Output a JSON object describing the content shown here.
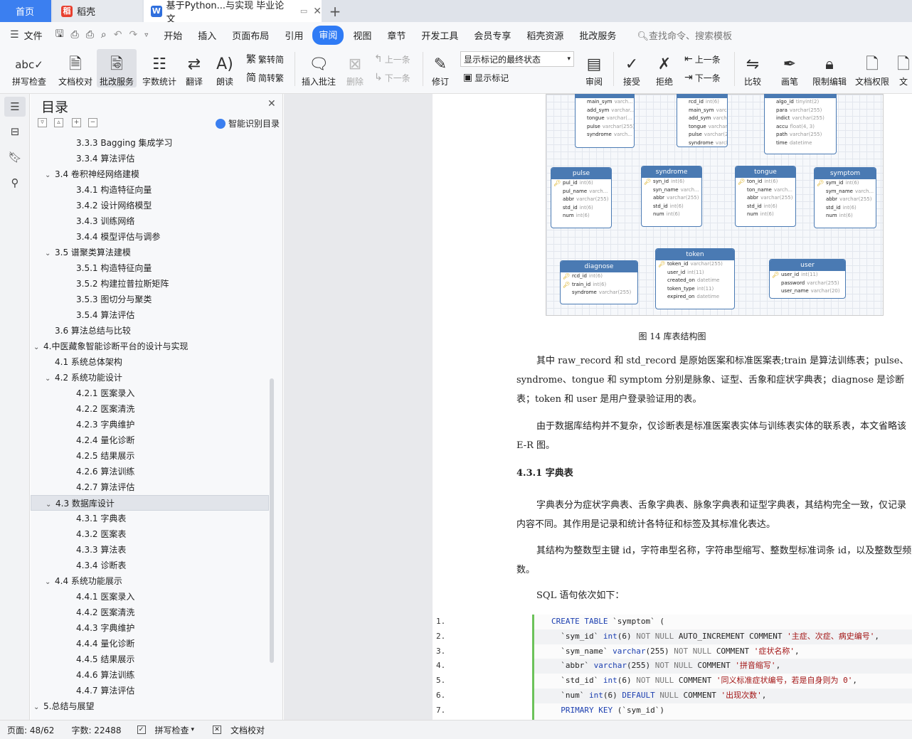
{
  "tabs": {
    "home": "首页",
    "daoke": "稻壳",
    "doc": "基于Python...与实现 毕业论文"
  },
  "menu": {
    "file": "文件",
    "items": [
      "开始",
      "插入",
      "页面布局",
      "引用",
      "审阅",
      "视图",
      "章节",
      "开发工具",
      "会员专享",
      "稻壳资源",
      "批改服务"
    ],
    "active_index": 4,
    "search": "查找命令、搜索模板"
  },
  "ribbon": {
    "spell": "拼写检查",
    "proofread": "文档校对",
    "review_service": "批改服务",
    "wordcount": "字数统计",
    "translate": "翻译",
    "read_aloud": "朗读",
    "trad_simp": "繁转简",
    "simp_trad": "简转繁",
    "insert_comment": "插入批注",
    "delete": "删除",
    "prev": "上一条",
    "next": "下一条",
    "revise": "修订",
    "mark_state": "显示标记的最终状态",
    "show_marks": "显示标记",
    "review": "审阅",
    "accept": "接受",
    "reject": "拒绝",
    "prev2": "上一条",
    "next2": "下一条",
    "compare": "比较",
    "brush": "画笔",
    "restrict": "限制编辑",
    "permission": "文档权限",
    "more": "文"
  },
  "toc": {
    "title": "目录",
    "smart": "智能识别目录",
    "items": [
      {
        "level": 3,
        "text": "3.3.3 Bagging 集成学习"
      },
      {
        "level": 3,
        "text": "3.3.4 算法评估"
      },
      {
        "level": 2,
        "text": "3.4 卷积神经网络建模",
        "caret": true
      },
      {
        "level": 3,
        "text": "3.4.1 构造特征向量"
      },
      {
        "level": 3,
        "text": "3.4.2 设计网络模型"
      },
      {
        "level": 3,
        "text": "3.4.3  训练网络"
      },
      {
        "level": 3,
        "text": "3.4.4 模型评估与调参"
      },
      {
        "level": 2,
        "text": "3.5 谱聚类算法建模",
        "caret": true
      },
      {
        "level": 3,
        "text": "3.5.1 构造特征向量"
      },
      {
        "level": 3,
        "text": "3.5.2 构建拉普拉斯矩阵"
      },
      {
        "level": 3,
        "text": "3.5.3 图切分与聚类"
      },
      {
        "level": 3,
        "text": "3.5.4 算法评估"
      },
      {
        "level": 2,
        "text": "3.6 算法总结与比较"
      },
      {
        "level": 1,
        "text": "4.中医藏象智能诊断平台的设计与实现",
        "caret": true
      },
      {
        "level": 2,
        "text": "4.1 系统总体架构"
      },
      {
        "level": 2,
        "text": "4.2 系统功能设计",
        "caret": true
      },
      {
        "level": 3,
        "text": "4.2.1 医案录入"
      },
      {
        "level": 3,
        "text": "4.2.2 医案清洗"
      },
      {
        "level": 3,
        "text": "4.2.3 字典维护"
      },
      {
        "level": 3,
        "text": "4.2.4 量化诊断"
      },
      {
        "level": 3,
        "text": "4.2.5 结果展示"
      },
      {
        "level": 3,
        "text": "4.2.6 算法训练"
      },
      {
        "level": 3,
        "text": "4.2.7 算法评估"
      },
      {
        "level": 2,
        "text": "4.3 数据库设计",
        "caret": true,
        "selected": true
      },
      {
        "level": 3,
        "text": "4.3.1 字典表"
      },
      {
        "level": 3,
        "text": "4.3.2 医案表"
      },
      {
        "level": 3,
        "text": "4.3.3 算法表"
      },
      {
        "level": 3,
        "text": "4.3.4 诊断表"
      },
      {
        "level": 2,
        "text": "4.4 系统功能展示",
        "caret": true
      },
      {
        "level": 3,
        "text": "4.4.1 医案录入"
      },
      {
        "level": 3,
        "text": "4.4.2 医案清洗"
      },
      {
        "level": 3,
        "text": "4.4.3 字典维护"
      },
      {
        "level": 3,
        "text": "4.4.4 量化诊断"
      },
      {
        "level": 3,
        "text": "4.4.5 结果展示"
      },
      {
        "level": 3,
        "text": "4.4.6 算法训练"
      },
      {
        "level": 3,
        "text": "4.4.7 算法评估"
      },
      {
        "level": 1,
        "text": "5.总结与展望",
        "caret": true
      }
    ]
  },
  "er": {
    "tables": [
      {
        "name": "",
        "fields": [
          [
            "",
            "main_sym",
            "varch..."
          ],
          [
            "",
            "add_sym",
            "varchar..."
          ],
          [
            "",
            "tongue",
            "varchar(..."
          ],
          [
            "",
            "pulse",
            "varchar(255)"
          ],
          [
            "",
            "syndrome",
            "varch..."
          ]
        ]
      },
      {
        "name": "",
        "fields": [
          [
            "",
            "rcd_id",
            "int(6)"
          ],
          [
            "",
            "main_sym",
            "varch..."
          ],
          [
            "",
            "add_sym",
            "varchar..."
          ],
          [
            "",
            "tongue",
            "varchar(..."
          ],
          [
            "",
            "pulse",
            "varchar(255)"
          ],
          [
            "",
            "syndrome",
            "varch..."
          ]
        ]
      },
      {
        "name": "",
        "fields": [
          [
            "",
            "algo_id",
            "tinyint(2)"
          ],
          [
            "",
            "para",
            "varchar(255)"
          ],
          [
            "",
            "indict",
            "varchar(255)"
          ],
          [
            "",
            "accu",
            "float(4, 3)"
          ],
          [
            "",
            "path",
            "varchar(255)"
          ],
          [
            "",
            "time",
            "datetime"
          ]
        ]
      },
      {
        "name": "pulse",
        "fields": [
          [
            "k",
            "pul_id",
            "int(6)"
          ],
          [
            "",
            "pul_name",
            "varch..."
          ],
          [
            "",
            "abbr",
            "varchar(255)"
          ],
          [
            "",
            "std_id",
            "int(6)"
          ],
          [
            "",
            "num",
            "int(6)"
          ]
        ]
      },
      {
        "name": "syndrome",
        "fields": [
          [
            "k",
            "syn_id",
            "int(6)"
          ],
          [
            "",
            "syn_name",
            "varch..."
          ],
          [
            "",
            "abbr",
            "varchar(255)"
          ],
          [
            "",
            "std_id",
            "int(6)"
          ],
          [
            "",
            "num",
            "int(6)"
          ]
        ]
      },
      {
        "name": "tongue",
        "fields": [
          [
            "k",
            "ton_id",
            "int(6)"
          ],
          [
            "",
            "ton_name",
            "varch..."
          ],
          [
            "",
            "abbr",
            "varchar(255)"
          ],
          [
            "",
            "std_id",
            "int(6)"
          ],
          [
            "",
            "num",
            "int(6)"
          ]
        ]
      },
      {
        "name": "symptom",
        "fields": [
          [
            "k",
            "sym_id",
            "int(6)"
          ],
          [
            "",
            "sym_name",
            "varch..."
          ],
          [
            "",
            "abbr",
            "varchar(255)"
          ],
          [
            "",
            "std_id",
            "int(6)"
          ],
          [
            "",
            "num",
            "int(6)"
          ]
        ]
      },
      {
        "name": "diagnose",
        "fields": [
          [
            "k",
            "rcd_id",
            "int(6)"
          ],
          [
            "k",
            "train_id",
            "int(6)"
          ],
          [
            "",
            "syndrome",
            "varchar(255)"
          ]
        ]
      },
      {
        "name": "token",
        "fields": [
          [
            "k",
            "token_id",
            "varchar(255)"
          ],
          [
            "",
            "user_id",
            "int(11)"
          ],
          [
            "",
            "created_on",
            "datetime"
          ],
          [
            "",
            "token_type",
            "int(11)"
          ],
          [
            "",
            "expired_on",
            "datetime"
          ]
        ]
      },
      {
        "name": "user",
        "fields": [
          [
            "k",
            "user_id",
            "int(11)"
          ],
          [
            "",
            "password",
            "varchar(255)"
          ],
          [
            "",
            "user_name",
            "varchar(20)"
          ]
        ]
      }
    ]
  },
  "doc": {
    "caption": "图 14  库表结构图",
    "p1": "其中 raw_record 和 std_record 是原始医案和标准医案表;train 是算法训练表；pulse、syndrome、tongue 和 symptom 分别是脉象、证型、舌象和症状字典表；diagnose 是诊断表；token 和 user 是用户登录验证用的表。",
    "p2": "由于数据库结构并不复杂，仅诊断表是标准医案表实体与训练表实体的联系表，本文省略该 E-R 图。",
    "h431": "4.3.1 字典表",
    "p3": "字典表分为症状字典表、舌象字典表、脉象字典表和证型字典表，其结构完全一致，仅记录内容不同。其作用是记录和统计各特征和标签及其标准化表达。",
    "p4": "其结构为整数型主键 id，字符串型名称，字符串型缩写、整数型标准词条 id，以及整数型频数。",
    "sql_intro": "SQL 语句依次如下：",
    "code": [
      {
        "n": "1.",
        "segs": [
          [
            "kw",
            "CREATE TABLE "
          ],
          [
            "",
            "`symptom` ("
          ]
        ]
      },
      {
        "n": "2.",
        "segs": [
          [
            "",
            "  `sym_id` "
          ],
          [
            "kw",
            "int"
          ],
          [
            "",
            "(6) "
          ],
          [
            "kw2",
            "NOT NULL "
          ],
          [
            "",
            "AUTO_INCREMENT COMMENT "
          ],
          [
            "str",
            "'主症、次症、病史编号'"
          ],
          [
            "",
            ","
          ]
        ]
      },
      {
        "n": "3.",
        "segs": [
          [
            "",
            "  `sym_name` "
          ],
          [
            "kw",
            "varchar"
          ],
          [
            "",
            "(255) "
          ],
          [
            "kw2",
            "NOT NULL "
          ],
          [
            "",
            "COMMENT "
          ],
          [
            "str",
            "'症状名称'"
          ],
          [
            "",
            ","
          ]
        ]
      },
      {
        "n": "4.",
        "segs": [
          [
            "",
            "  `abbr` "
          ],
          [
            "kw",
            "varchar"
          ],
          [
            "",
            "(255) "
          ],
          [
            "kw2",
            "NOT NULL "
          ],
          [
            "",
            "COMMENT "
          ],
          [
            "str",
            "'拼音缩写'"
          ],
          [
            "",
            ","
          ]
        ]
      },
      {
        "n": "5.",
        "segs": [
          [
            "",
            "  `std_id` "
          ],
          [
            "kw",
            "int"
          ],
          [
            "",
            "(6) "
          ],
          [
            "kw2",
            "NOT NULL "
          ],
          [
            "",
            "COMMENT "
          ],
          [
            "str",
            "'同义标准症状编号，若是自身则为 0'"
          ],
          [
            "",
            ","
          ]
        ]
      },
      {
        "n": "6.",
        "segs": [
          [
            "",
            "  `num` "
          ],
          [
            "kw",
            "int"
          ],
          [
            "",
            "(6) "
          ],
          [
            "kw",
            "DEFAULT "
          ],
          [
            "kw2",
            "NULL "
          ],
          [
            "",
            "COMMENT "
          ],
          [
            "str",
            "'出现次数'"
          ],
          [
            "",
            ","
          ]
        ]
      },
      {
        "n": "7.",
        "segs": [
          [
            "",
            "  "
          ],
          [
            "kw",
            "PRIMARY KEY "
          ],
          [
            "",
            "(`sym_id`)"
          ]
        ]
      }
    ]
  },
  "status": {
    "page": "页面: 48/62",
    "words": "字数: 22488",
    "spell": "拼写检查",
    "proof": "文档校对"
  }
}
